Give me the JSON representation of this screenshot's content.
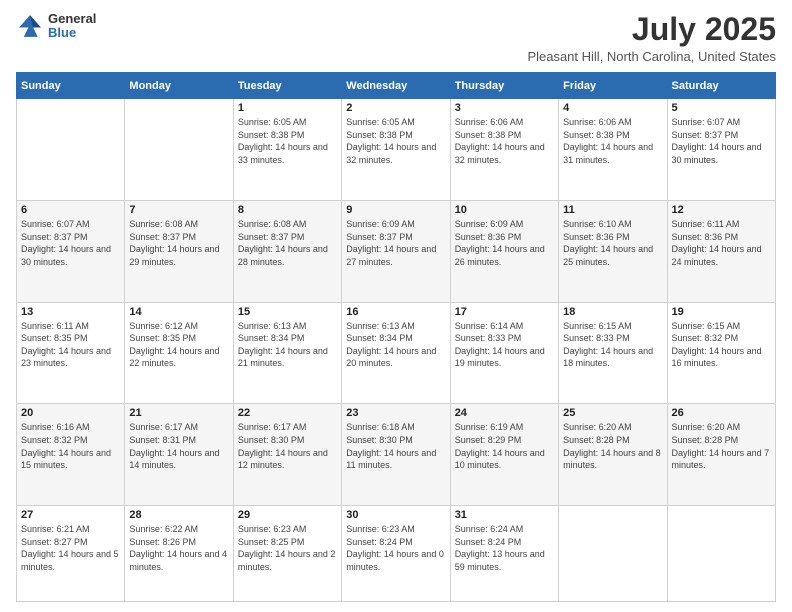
{
  "header": {
    "logo_general": "General",
    "logo_blue": "Blue",
    "title": "July 2025",
    "subtitle": "Pleasant Hill, North Carolina, United States"
  },
  "days_of_week": [
    "Sunday",
    "Monday",
    "Tuesday",
    "Wednesday",
    "Thursday",
    "Friday",
    "Saturday"
  ],
  "weeks": [
    [
      {
        "day": "",
        "sunrise": "",
        "sunset": "",
        "daylight": ""
      },
      {
        "day": "",
        "sunrise": "",
        "sunset": "",
        "daylight": ""
      },
      {
        "day": "1",
        "sunrise": "Sunrise: 6:05 AM",
        "sunset": "Sunset: 8:38 PM",
        "daylight": "Daylight: 14 hours and 33 minutes."
      },
      {
        "day": "2",
        "sunrise": "Sunrise: 6:05 AM",
        "sunset": "Sunset: 8:38 PM",
        "daylight": "Daylight: 14 hours and 32 minutes."
      },
      {
        "day": "3",
        "sunrise": "Sunrise: 6:06 AM",
        "sunset": "Sunset: 8:38 PM",
        "daylight": "Daylight: 14 hours and 32 minutes."
      },
      {
        "day": "4",
        "sunrise": "Sunrise: 6:06 AM",
        "sunset": "Sunset: 8:38 PM",
        "daylight": "Daylight: 14 hours and 31 minutes."
      },
      {
        "day": "5",
        "sunrise": "Sunrise: 6:07 AM",
        "sunset": "Sunset: 8:37 PM",
        "daylight": "Daylight: 14 hours and 30 minutes."
      }
    ],
    [
      {
        "day": "6",
        "sunrise": "Sunrise: 6:07 AM",
        "sunset": "Sunset: 8:37 PM",
        "daylight": "Daylight: 14 hours and 30 minutes."
      },
      {
        "day": "7",
        "sunrise": "Sunrise: 6:08 AM",
        "sunset": "Sunset: 8:37 PM",
        "daylight": "Daylight: 14 hours and 29 minutes."
      },
      {
        "day": "8",
        "sunrise": "Sunrise: 6:08 AM",
        "sunset": "Sunset: 8:37 PM",
        "daylight": "Daylight: 14 hours and 28 minutes."
      },
      {
        "day": "9",
        "sunrise": "Sunrise: 6:09 AM",
        "sunset": "Sunset: 8:37 PM",
        "daylight": "Daylight: 14 hours and 27 minutes."
      },
      {
        "day": "10",
        "sunrise": "Sunrise: 6:09 AM",
        "sunset": "Sunset: 8:36 PM",
        "daylight": "Daylight: 14 hours and 26 minutes."
      },
      {
        "day": "11",
        "sunrise": "Sunrise: 6:10 AM",
        "sunset": "Sunset: 8:36 PM",
        "daylight": "Daylight: 14 hours and 25 minutes."
      },
      {
        "day": "12",
        "sunrise": "Sunrise: 6:11 AM",
        "sunset": "Sunset: 8:36 PM",
        "daylight": "Daylight: 14 hours and 24 minutes."
      }
    ],
    [
      {
        "day": "13",
        "sunrise": "Sunrise: 6:11 AM",
        "sunset": "Sunset: 8:35 PM",
        "daylight": "Daylight: 14 hours and 23 minutes."
      },
      {
        "day": "14",
        "sunrise": "Sunrise: 6:12 AM",
        "sunset": "Sunset: 8:35 PM",
        "daylight": "Daylight: 14 hours and 22 minutes."
      },
      {
        "day": "15",
        "sunrise": "Sunrise: 6:13 AM",
        "sunset": "Sunset: 8:34 PM",
        "daylight": "Daylight: 14 hours and 21 minutes."
      },
      {
        "day": "16",
        "sunrise": "Sunrise: 6:13 AM",
        "sunset": "Sunset: 8:34 PM",
        "daylight": "Daylight: 14 hours and 20 minutes."
      },
      {
        "day": "17",
        "sunrise": "Sunrise: 6:14 AM",
        "sunset": "Sunset: 8:33 PM",
        "daylight": "Daylight: 14 hours and 19 minutes."
      },
      {
        "day": "18",
        "sunrise": "Sunrise: 6:15 AM",
        "sunset": "Sunset: 8:33 PM",
        "daylight": "Daylight: 14 hours and 18 minutes."
      },
      {
        "day": "19",
        "sunrise": "Sunrise: 6:15 AM",
        "sunset": "Sunset: 8:32 PM",
        "daylight": "Daylight: 14 hours and 16 minutes."
      }
    ],
    [
      {
        "day": "20",
        "sunrise": "Sunrise: 6:16 AM",
        "sunset": "Sunset: 8:32 PM",
        "daylight": "Daylight: 14 hours and 15 minutes."
      },
      {
        "day": "21",
        "sunrise": "Sunrise: 6:17 AM",
        "sunset": "Sunset: 8:31 PM",
        "daylight": "Daylight: 14 hours and 14 minutes."
      },
      {
        "day": "22",
        "sunrise": "Sunrise: 6:17 AM",
        "sunset": "Sunset: 8:30 PM",
        "daylight": "Daylight: 14 hours and 12 minutes."
      },
      {
        "day": "23",
        "sunrise": "Sunrise: 6:18 AM",
        "sunset": "Sunset: 8:30 PM",
        "daylight": "Daylight: 14 hours and 11 minutes."
      },
      {
        "day": "24",
        "sunrise": "Sunrise: 6:19 AM",
        "sunset": "Sunset: 8:29 PM",
        "daylight": "Daylight: 14 hours and 10 minutes."
      },
      {
        "day": "25",
        "sunrise": "Sunrise: 6:20 AM",
        "sunset": "Sunset: 8:28 PM",
        "daylight": "Daylight: 14 hours and 8 minutes."
      },
      {
        "day": "26",
        "sunrise": "Sunrise: 6:20 AM",
        "sunset": "Sunset: 8:28 PM",
        "daylight": "Daylight: 14 hours and 7 minutes."
      }
    ],
    [
      {
        "day": "27",
        "sunrise": "Sunrise: 6:21 AM",
        "sunset": "Sunset: 8:27 PM",
        "daylight": "Daylight: 14 hours and 5 minutes."
      },
      {
        "day": "28",
        "sunrise": "Sunrise: 6:22 AM",
        "sunset": "Sunset: 8:26 PM",
        "daylight": "Daylight: 14 hours and 4 minutes."
      },
      {
        "day": "29",
        "sunrise": "Sunrise: 6:23 AM",
        "sunset": "Sunset: 8:25 PM",
        "daylight": "Daylight: 14 hours and 2 minutes."
      },
      {
        "day": "30",
        "sunrise": "Sunrise: 6:23 AM",
        "sunset": "Sunset: 8:24 PM",
        "daylight": "Daylight: 14 hours and 0 minutes."
      },
      {
        "day": "31",
        "sunrise": "Sunrise: 6:24 AM",
        "sunset": "Sunset: 8:24 PM",
        "daylight": "Daylight: 13 hours and 59 minutes."
      },
      {
        "day": "",
        "sunrise": "",
        "sunset": "",
        "daylight": ""
      },
      {
        "day": "",
        "sunrise": "",
        "sunset": "",
        "daylight": ""
      }
    ]
  ]
}
